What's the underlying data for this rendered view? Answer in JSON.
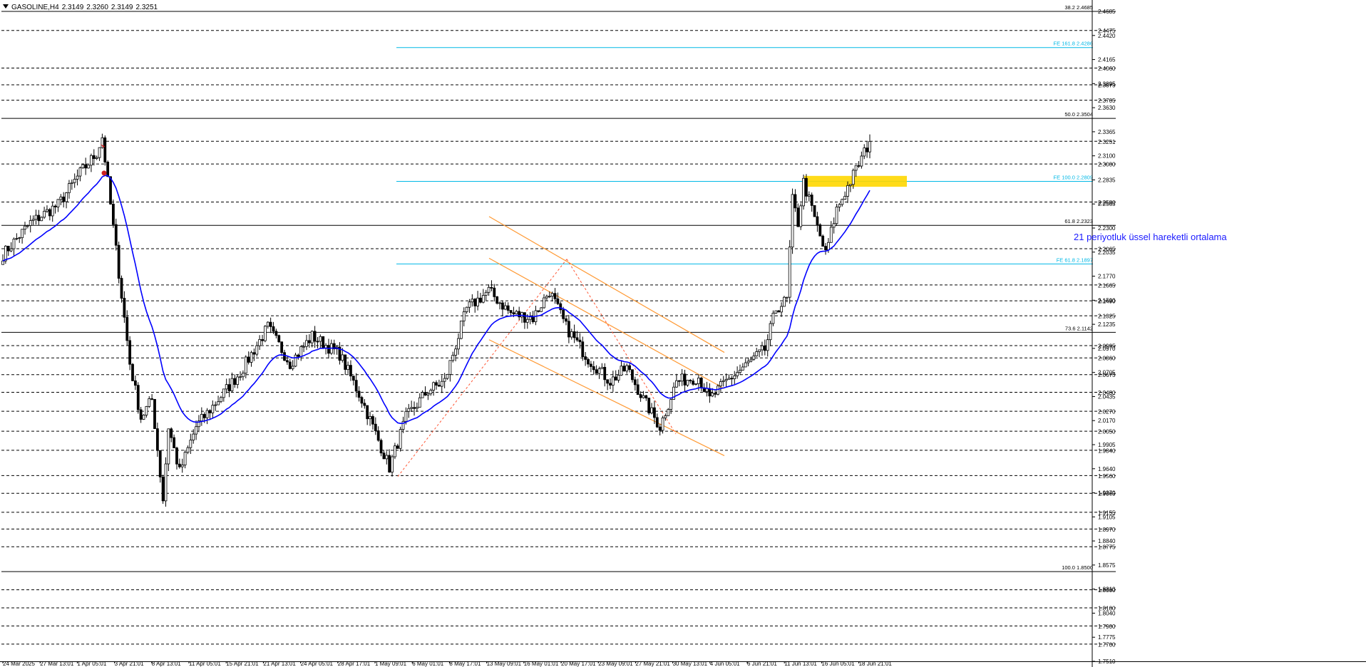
{
  "header": {
    "symbol": "GASOLINE,H4",
    "open": "2.3149",
    "high": "2.3260",
    "low": "2.3149",
    "close": "2.3251"
  },
  "colors": {
    "background": "#ffffff",
    "candle": "#000000",
    "ema": "#0000ff",
    "channel": "#ff9933",
    "fib_ext": "#00b8e6",
    "highlight_zone": "#ffd700",
    "dashed_levels": "#000000"
  },
  "chart_data": {
    "type": "candlestick",
    "title": "GASOLINE,H4",
    "ylim": [
      1.751,
      2.4685
    ],
    "x_tick_labels": [
      "24 Mar 2025",
      "27 Mar 13:01",
      "1 Apr 05:01",
      "3 Apr 21:01",
      "8 Apr 13:01",
      "11 Apr 05:01",
      "15 Apr 21:01",
      "21 Apr 13:01",
      "24 Apr 05:01",
      "28 Apr 17:01",
      "1 May 09:01",
      "6 May 01:01",
      "8 May 17:01",
      "13 May 09:01",
      "16 May 01:01",
      "20 May 17:01",
      "23 May 09:01",
      "27 May 21:01",
      "30 May 13:01",
      "4 Jun 05:01",
      "6 Jun 21:01",
      "11 Jun 13:01",
      "16 Jun 05:01",
      "18 Jun 21:01"
    ],
    "y_tick_labels": [
      "2.4685",
      "2.4420",
      "2.4165",
      "2.3895",
      "2.3630",
      "2.3365",
      "2.3100",
      "2.2835",
      "2.2565",
      "2.2300",
      "2.2035",
      "2.1770",
      "2.1500",
      "2.1235",
      "2.0970",
      "2.0705",
      "2.0435",
      "2.0170",
      "1.9905",
      "1.9640",
      "1.9370",
      "1.9105",
      "1.8840",
      "1.8575",
      "1.8310",
      "1.8040",
      "1.7775",
      "1.7510"
    ],
    "levels": [
      2.4475,
      2.406,
      2.3875,
      2.3705,
      2.3251,
      2.3,
      2.258,
      2.2065,
      2.1665,
      2.149,
      2.1325,
      2.0995,
      2.086,
      2.0675,
      2.048,
      2.027,
      2.005,
      1.984,
      1.956,
      1.9365,
      1.9155,
      1.897,
      1.8775,
      1.83,
      1.81,
      1.79,
      1.77
    ],
    "level_labels": [
      "2.4475",
      "2.4060",
      "2.3875",
      "2.3705",
      "2.3251",
      "2.3000",
      "2.2580",
      "2.2065",
      "2.1665",
      "2.1490",
      "2.1325",
      "2.0995",
      "2.0860",
      "2.0675",
      "2.0480",
      "2.0270",
      "2.0050",
      "1.9840",
      "1.9560",
      "1.9365",
      "1.9155",
      "1.8970",
      "1.8775",
      "1.8300",
      "1.8100",
      "1.7900",
      "1.7700"
    ],
    "fib_retracement": [
      {
        "label": "38.2 2.4685",
        "value": 2.4685
      },
      {
        "label": "50.0 2.3504",
        "value": 2.3504
      },
      {
        "label": "61.8 2.2323",
        "value": 2.2323
      },
      {
        "label": "73.6 2.1142",
        "value": 2.1142
      },
      {
        "label": "100.0 1.8500",
        "value": 1.85
      }
    ],
    "fib_expansion": [
      {
        "label": "FE 161.8 2.4286",
        "value": 2.4286
      },
      {
        "label": "FE 100.0 2.2809",
        "value": 2.2809
      },
      {
        "label": "FE 61.8 2.1897",
        "value": 2.1897
      }
    ],
    "series": [
      {
        "name": "GASOLINE,H4",
        "anchors": [
          {
            "t": 0,
            "price": 2.2
          },
          {
            "t": 10,
            "price": 2.235
          },
          {
            "t": 20,
            "price": 2.255
          },
          {
            "t": 28,
            "price": 2.29
          },
          {
            "t": 34,
            "price": 2.312
          },
          {
            "t": 36,
            "price": 2.33
          },
          {
            "t": 38,
            "price": 2.28
          },
          {
            "t": 42,
            "price": 2.18
          },
          {
            "t": 46,
            "price": 2.08
          },
          {
            "t": 50,
            "price": 2.02
          },
          {
            "t": 54,
            "price": 2.04
          },
          {
            "t": 58,
            "price": 1.93
          },
          {
            "t": 60,
            "price": 2.01
          },
          {
            "t": 64,
            "price": 1.96
          },
          {
            "t": 70,
            "price": 2.01
          },
          {
            "t": 78,
            "price": 2.04
          },
          {
            "t": 86,
            "price": 2.07
          },
          {
            "t": 96,
            "price": 2.12
          },
          {
            "t": 104,
            "price": 2.08
          },
          {
            "t": 112,
            "price": 2.11
          },
          {
            "t": 122,
            "price": 2.09
          },
          {
            "t": 130,
            "price": 2.04
          },
          {
            "t": 136,
            "price": 1.995
          },
          {
            "t": 140,
            "price": 1.965
          },
          {
            "t": 146,
            "price": 2.02
          },
          {
            "t": 154,
            "price": 2.05
          },
          {
            "t": 160,
            "price": 2.06
          },
          {
            "t": 168,
            "price": 2.14
          },
          {
            "t": 176,
            "price": 2.16
          },
          {
            "t": 184,
            "price": 2.135
          },
          {
            "t": 192,
            "price": 2.13
          },
          {
            "t": 198,
            "price": 2.16
          },
          {
            "t": 204,
            "price": 2.12
          },
          {
            "t": 212,
            "price": 2.085
          },
          {
            "t": 220,
            "price": 2.06
          },
          {
            "t": 226,
            "price": 2.075
          },
          {
            "t": 232,
            "price": 2.04
          },
          {
            "t": 238,
            "price": 2.01
          },
          {
            "t": 244,
            "price": 2.06
          },
          {
            "t": 252,
            "price": 2.065
          },
          {
            "t": 256,
            "price": 2.04
          },
          {
            "t": 262,
            "price": 2.06
          },
          {
            "t": 268,
            "price": 2.075
          },
          {
            "t": 276,
            "price": 2.095
          },
          {
            "t": 280,
            "price": 2.14
          },
          {
            "t": 284,
            "price": 2.15
          },
          {
            "t": 286,
            "price": 2.26
          },
          {
            "t": 288,
            "price": 2.235
          },
          {
            "t": 290,
            "price": 2.28
          },
          {
            "t": 294,
            "price": 2.24
          },
          {
            "t": 298,
            "price": 2.2
          },
          {
            "t": 302,
            "price": 2.25
          },
          {
            "t": 306,
            "price": 2.275
          },
          {
            "t": 310,
            "price": 2.3
          },
          {
            "t": 314,
            "price": 2.325
          }
        ]
      },
      {
        "name": "21 periyotluk üssel hareketli ortalama",
        "period": 21
      }
    ],
    "annotations": [
      "21 periyotluk üssel hareketli ortalama"
    ]
  },
  "annotation_text": "21 periyotluk üssel hareketli ortalama"
}
